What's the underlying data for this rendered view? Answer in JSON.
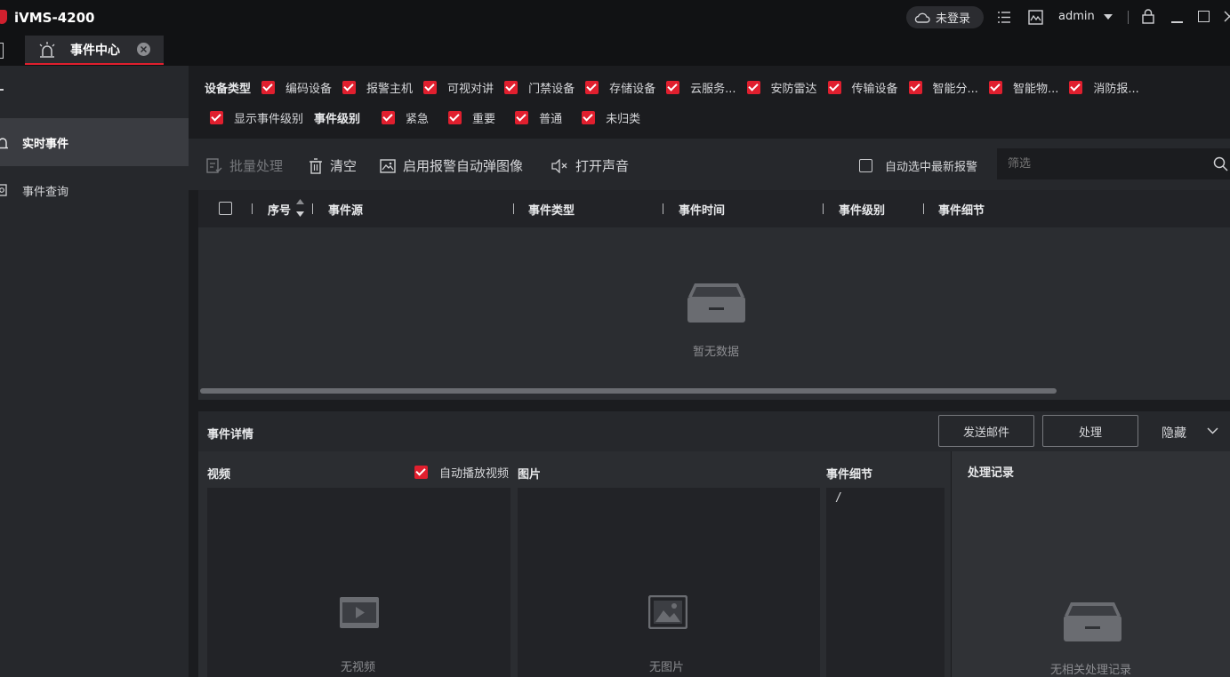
{
  "app": {
    "title": "iVMS-4200"
  },
  "titlebar": {
    "login_status": "未登录",
    "user": "admin"
  },
  "tabs": [
    {
      "label": "事件中心"
    }
  ],
  "sidebar": {
    "items": [
      {
        "label": "实时事件"
      },
      {
        "label": "事件查询"
      }
    ]
  },
  "filters": {
    "device_type_label": "设备类型",
    "device_types": [
      "编码设备",
      "报警主机",
      "可视对讲",
      "门禁设备",
      "存储设备",
      "云服务...",
      "安防雷达",
      "传输设备",
      "智能分...",
      "智能物...",
      "消防报..."
    ],
    "show_level_label": "显示事件级别",
    "level_label": "事件级别",
    "levels": [
      "紧急",
      "重要",
      "普通",
      "未归类"
    ]
  },
  "toolbar": {
    "batch": "批量处理",
    "clear": "清空",
    "popup": "启用报警自动弹图像",
    "sound": "打开声音",
    "auto_select": "自动选中最新报警",
    "filter_placeholder": "筛选"
  },
  "table": {
    "columns": [
      "序号",
      "事件源",
      "事件类型",
      "事件时间",
      "事件级别",
      "事件细节"
    ],
    "empty_text": "暂无数据"
  },
  "details": {
    "title": "事件详情",
    "send_email": "发送邮件",
    "process": "处理",
    "hide": "隐藏",
    "video_label": "视频",
    "auto_play": "自动播放视频",
    "picture_label": "图片",
    "detail_label": "事件细节",
    "detail_value": "/",
    "no_video": "无视频",
    "no_picture": "无图片",
    "record_label": "处理记录",
    "no_record": "无相关处理记录"
  },
  "colors": {
    "accent": "#e01f2e",
    "background": "#1b1c1f",
    "panel": "#26282c"
  }
}
